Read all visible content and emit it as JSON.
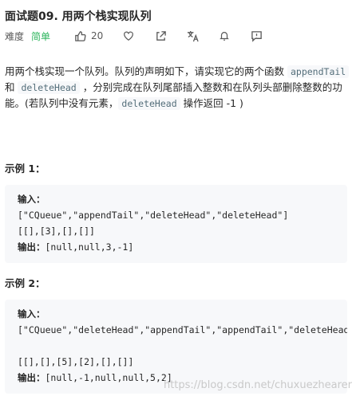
{
  "title": "面试题09. 用两个栈实现队列",
  "meta": {
    "difficulty_label": "难度",
    "difficulty": "简单",
    "likes": "20",
    "difficulty_color": "#2db55d"
  },
  "description": {
    "p1": "用两个栈实现一个队列。队列的声明如下，请实现它的两个函数 ",
    "code1": "appendTail",
    "p2": " 和 ",
    "code2": "deleteHead",
    "p3": " ，分别完成在队列尾部插入整数和在队列头部删除整数的功能。(若队列中没有元素，",
    "code3": "deleteHead",
    "p4": " 操作返回 -1 )"
  },
  "examples": [
    {
      "title": "示例 1：",
      "input_label": "输入：",
      "lines": [
        "[\"CQueue\",\"appendTail\",\"deleteHead\",\"deleteHead\"]",
        "[[],[3],[],[]]"
      ],
      "output_label": "输出：",
      "output": "[null,null,3,-1]"
    },
    {
      "title": "示例 2：",
      "input_label": "输入：",
      "lines": [
        "[\"CQueue\",\"deleteHead\",\"appendTail\",\"appendTail\",\"deleteHead\",\"deleteHead\"]",
        "",
        "[[],[],[5],[2],[],[]]"
      ],
      "output_label": "输出：",
      "output": "[null,-1,null,null,5,2]"
    }
  ],
  "watermark": "https://blog.csdn.net/chuxuezhearer"
}
